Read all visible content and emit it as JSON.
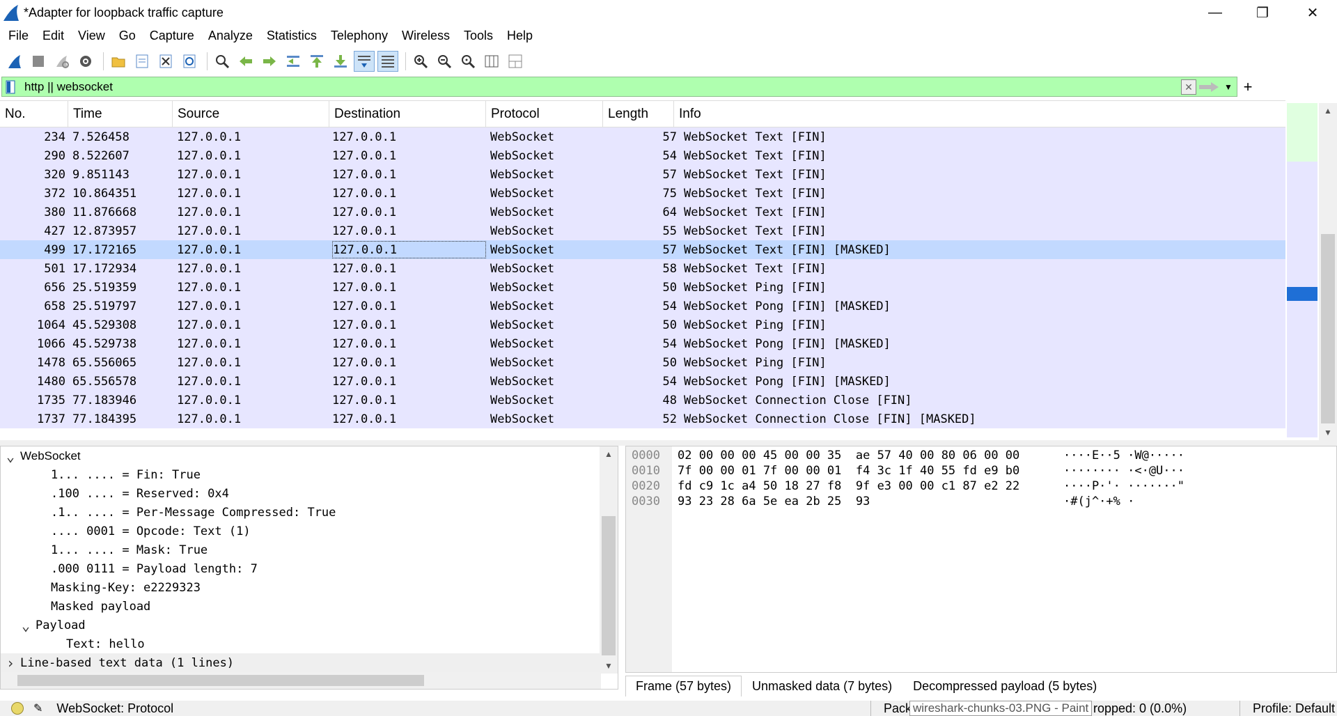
{
  "window": {
    "title": "*Adapter for loopback traffic capture",
    "controls": {
      "minimize": "—",
      "restore": "❐",
      "close": "✕"
    }
  },
  "menu": [
    "File",
    "Edit",
    "View",
    "Go",
    "Capture",
    "Analyze",
    "Statistics",
    "Telephony",
    "Wireless",
    "Tools",
    "Help"
  ],
  "toolbar": {
    "icons": [
      "shark-fin-start-icon",
      "stop-icon",
      "restart-icon",
      "capture-options-icon",
      "open-file-icon",
      "save-file-icon",
      "close-file-icon",
      "reload-icon",
      "find-packet-icon",
      "go-back-icon",
      "go-forward-icon",
      "go-to-packet-icon",
      "go-first-icon",
      "go-last-icon",
      "autoscroll-icon",
      "colorize-icon",
      "zoom-in-icon",
      "zoom-out-icon",
      "zoom-reset-icon",
      "resize-columns-icon",
      "layout-icon"
    ]
  },
  "filter": {
    "value": "http || websocket",
    "color": "#afffaf",
    "add_label": "+"
  },
  "packet_list": {
    "columns": [
      "No.",
      "Time",
      "Source",
      "Destination",
      "Protocol",
      "Length",
      "Info"
    ],
    "selected_index": 6,
    "row_color": "#e7e6ff",
    "selected_color": "#c2d9ff",
    "rows": [
      {
        "no": "234",
        "time": "7.526458",
        "src": "127.0.0.1",
        "dst": "127.0.0.1",
        "proto": "WebSocket",
        "len": "57",
        "info": "WebSocket Text [FIN]"
      },
      {
        "no": "290",
        "time": "8.522607",
        "src": "127.0.0.1",
        "dst": "127.0.0.1",
        "proto": "WebSocket",
        "len": "54",
        "info": "WebSocket Text [FIN]"
      },
      {
        "no": "320",
        "time": "9.851143",
        "src": "127.0.0.1",
        "dst": "127.0.0.1",
        "proto": "WebSocket",
        "len": "57",
        "info": "WebSocket Text [FIN]"
      },
      {
        "no": "372",
        "time": "10.864351",
        "src": "127.0.0.1",
        "dst": "127.0.0.1",
        "proto": "WebSocket",
        "len": "75",
        "info": "WebSocket Text [FIN]"
      },
      {
        "no": "380",
        "time": "11.876668",
        "src": "127.0.0.1",
        "dst": "127.0.0.1",
        "proto": "WebSocket",
        "len": "64",
        "info": "WebSocket Text [FIN]"
      },
      {
        "no": "427",
        "time": "12.873957",
        "src": "127.0.0.1",
        "dst": "127.0.0.1",
        "proto": "WebSocket",
        "len": "55",
        "info": "WebSocket Text [FIN]"
      },
      {
        "no": "499",
        "time": "17.172165",
        "src": "127.0.0.1",
        "dst": "127.0.0.1",
        "proto": "WebSocket",
        "len": "57",
        "info": "WebSocket Text [FIN] [MASKED]"
      },
      {
        "no": "501",
        "time": "17.172934",
        "src": "127.0.0.1",
        "dst": "127.0.0.1",
        "proto": "WebSocket",
        "len": "58",
        "info": "WebSocket Text [FIN]"
      },
      {
        "no": "656",
        "time": "25.519359",
        "src": "127.0.0.1",
        "dst": "127.0.0.1",
        "proto": "WebSocket",
        "len": "50",
        "info": "WebSocket Ping [FIN]"
      },
      {
        "no": "658",
        "time": "25.519797",
        "src": "127.0.0.1",
        "dst": "127.0.0.1",
        "proto": "WebSocket",
        "len": "54",
        "info": "WebSocket Pong [FIN] [MASKED]"
      },
      {
        "no": "1064",
        "time": "45.529308",
        "src": "127.0.0.1",
        "dst": "127.0.0.1",
        "proto": "WebSocket",
        "len": "50",
        "info": "WebSocket Ping [FIN]"
      },
      {
        "no": "1066",
        "time": "45.529738",
        "src": "127.0.0.1",
        "dst": "127.0.0.1",
        "proto": "WebSocket",
        "len": "54",
        "info": "WebSocket Pong [FIN] [MASKED]"
      },
      {
        "no": "1478",
        "time": "65.556065",
        "src": "127.0.0.1",
        "dst": "127.0.0.1",
        "proto": "WebSocket",
        "len": "50",
        "info": "WebSocket Ping [FIN]"
      },
      {
        "no": "1480",
        "time": "65.556578",
        "src": "127.0.0.1",
        "dst": "127.0.0.1",
        "proto": "WebSocket",
        "len": "54",
        "info": "WebSocket Pong [FIN] [MASKED]"
      },
      {
        "no": "1735",
        "time": "77.183946",
        "src": "127.0.0.1",
        "dst": "127.0.0.1",
        "proto": "WebSocket",
        "len": "48",
        "info": "WebSocket Connection Close [FIN]"
      },
      {
        "no": "1737",
        "time": "77.184395",
        "src": "127.0.0.1",
        "dst": "127.0.0.1",
        "proto": "WebSocket",
        "len": "52",
        "info": "WebSocket Connection Close [FIN] [MASKED]"
      }
    ]
  },
  "details": [
    {
      "text": "WebSocket",
      "indent": 0,
      "twist": "v",
      "proto": true
    },
    {
      "text": "1... .... = Fin: True",
      "indent": 2
    },
    {
      "text": ".100 .... = Reserved: 0x4",
      "indent": 2
    },
    {
      "text": ".1.. .... = Per-Message Compressed: True",
      "indent": 2
    },
    {
      "text": ".... 0001 = Opcode: Text (1)",
      "indent": 2
    },
    {
      "text": "1... .... = Mask: True",
      "indent": 2
    },
    {
      "text": ".000 0111 = Payload length: 7",
      "indent": 2
    },
    {
      "text": "Masking-Key: e2229323",
      "indent": 2
    },
    {
      "text": "Masked payload",
      "indent": 2
    },
    {
      "text": "Payload",
      "indent": 1,
      "twist": "v"
    },
    {
      "text": "Text: hello",
      "indent": 3
    },
    {
      "text": "Line-based text data (1 lines)",
      "indent": 0,
      "twist": ">",
      "highlight": true
    }
  ],
  "bytes": [
    {
      "offset": "0000",
      "hex": "02 00 00 00 45 00 00 35  ae 57 40 00 80 06 00 00",
      "ascii": "····E··5 ·W@·····"
    },
    {
      "offset": "0010",
      "hex": "7f 00 00 01 7f 00 00 01  f4 3c 1f 40 55 fd e9 b0",
      "ascii": "········ ·<·@U···"
    },
    {
      "offset": "0020",
      "hex": "fd c9 1c a4 50 18 27 f8  9f e3 00 00 c1 87 e2 22",
      "ascii": "····P·'· ·······\""
    },
    {
      "offset": "0030",
      "hex": "93 23 28 6a 5e ea 2b 25  93",
      "ascii": "·#(j^·+% ·"
    }
  ],
  "bytes_tabs": [
    "Frame (57 bytes)",
    "Unmasked data (7 bytes)",
    "Decompressed payload (5 bytes)"
  ],
  "status": {
    "text": "WebSocket: Protocol",
    "packets": "Pack",
    "tooltip": "wireshark-chunks-03.PNG - Paint",
    "dropped": "ropped: 0 (0.0%)",
    "profile": "Profile: Default"
  }
}
